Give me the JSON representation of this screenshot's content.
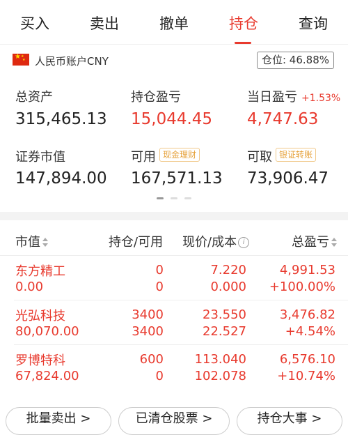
{
  "tabs": [
    {
      "label": "买入"
    },
    {
      "label": "卖出"
    },
    {
      "label": "撤单"
    },
    {
      "label": "持仓"
    },
    {
      "label": "查询"
    }
  ],
  "active_tab": "持仓",
  "account": {
    "name": "人民币账户CNY",
    "position_label": "仓位: 46.88%"
  },
  "summary": {
    "total_assets_label": "总资产",
    "total_assets": "315,465.13",
    "holding_pl_label": "持仓盈亏",
    "holding_pl": "15,044.45",
    "daily_pl_label": "当日盈亏",
    "daily_pl_pct": "+1.53%",
    "daily_pl": "4,747.63",
    "market_value_label": "证券市值",
    "market_value": "147,894.00",
    "available_label": "可用",
    "available_tag": "现金理财",
    "available": "167,571.13",
    "withdrawable_label": "可取",
    "withdrawable_tag": "银证转账",
    "withdrawable": "73,906.47"
  },
  "table": {
    "headers": {
      "market_value": "市值",
      "holding": "持仓/可用",
      "price": "现价/成本",
      "pl": "总盈亏"
    },
    "rows": [
      {
        "name": "东方精工",
        "market_value": "0.00",
        "holding": "0",
        "available": "0",
        "price": "7.220",
        "cost": "0.000",
        "pl": "4,991.53",
        "pl_pct": "+100.00%"
      },
      {
        "name": "光弘科技",
        "market_value": "80,070.00",
        "holding": "3400",
        "available": "3400",
        "price": "23.550",
        "cost": "22.527",
        "pl": "3,476.82",
        "pl_pct": "+4.54%"
      },
      {
        "name": "罗博特科",
        "market_value": "67,824.00",
        "holding": "600",
        "available": "0",
        "price": "113.040",
        "cost": "102.078",
        "pl": "6,576.10",
        "pl_pct": "+10.74%"
      }
    ]
  },
  "bottom_buttons": [
    {
      "label": "批量卖出 >"
    },
    {
      "label": "已清仓股票 >"
    },
    {
      "label": "持仓大事 >"
    }
  ],
  "colors": {
    "accent_red": "#e83a2e",
    "tag_orange": "#e6a23c"
  },
  "carousel": {
    "pages": 3,
    "active_index": 0
  }
}
